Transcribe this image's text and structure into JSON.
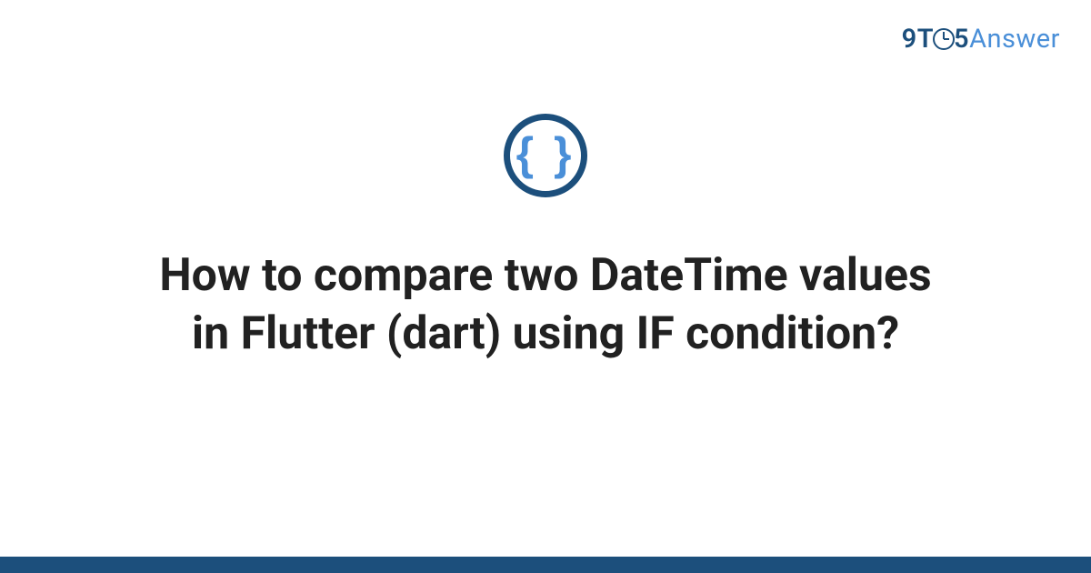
{
  "logo": {
    "nine": "9",
    "t": "T",
    "five": "5",
    "answer": "Answer"
  },
  "icon": {
    "braces": "{ }",
    "name": "code-braces-icon"
  },
  "title": "How to compare two DateTime values in Flutter (dart) using IF condition?",
  "colors": {
    "brand_dark": "#1c4f7c",
    "brand_light": "#4a8fd8"
  }
}
